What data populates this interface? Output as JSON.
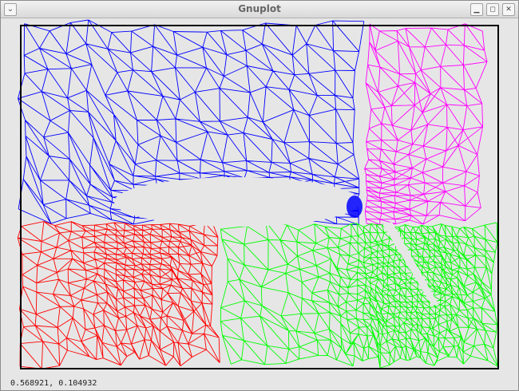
{
  "window": {
    "title": "Gnuplot",
    "menu_glyph": "⌄",
    "minimize_glyph": "▁",
    "maximize_glyph": "◻",
    "close_glyph": "✕"
  },
  "status": {
    "coordinates": "0.568921,   0.104932"
  },
  "colors": {
    "upper_left": "#0000ff",
    "upper_right": "#ff00ff",
    "lower_left": "#ff0000",
    "lower_right": "#00ff00",
    "frame": "#000000",
    "background": "#e6e6e6"
  }
}
